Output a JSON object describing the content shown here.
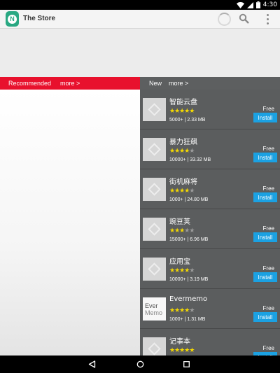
{
  "status_bar": {
    "time": "4:30",
    "icons": [
      "wifi-icon",
      "cellular-signal-icon",
      "battery-icon"
    ]
  },
  "action_bar": {
    "title": "The Store",
    "app_icon_letter": "N"
  },
  "recommended": {
    "label": "Recommended",
    "more": "more >"
  },
  "new_section": {
    "label": "New",
    "more": "more >",
    "apps": [
      {
        "name": "智能云盘",
        "rating": 5,
        "meta": "5000+ | 2.33 MB",
        "price": "Free",
        "install": "Install",
        "thumb": "placeholder"
      },
      {
        "name": "暴力狂飙",
        "rating": 4,
        "meta": "10000+ | 33.32 MB",
        "price": "Free",
        "install": "Install",
        "thumb": "placeholder"
      },
      {
        "name": "街机麻将",
        "rating": 4,
        "meta": "1000+ | 24.80 MB",
        "price": "Free",
        "install": "Install",
        "thumb": "placeholder"
      },
      {
        "name": "豌豆荚",
        "rating": 3,
        "meta": "15000+ | 6.96 MB",
        "price": "Free",
        "install": "Install",
        "thumb": "placeholder"
      },
      {
        "name": "应用宝",
        "rating": 4,
        "meta": "10000+ | 3.19 MB",
        "price": "Free",
        "install": "Install",
        "thumb": "placeholder"
      },
      {
        "name": "Evermemo",
        "rating": 4,
        "meta": "1000+ | 1.31 MB",
        "price": "Free",
        "install": "Install",
        "thumb": "evermemo",
        "thumb_text": [
          "Ever",
          "Memo"
        ]
      },
      {
        "name": "记事本",
        "rating": 5,
        "meta": "",
        "price": "Free",
        "install": "Install",
        "thumb": "placeholder"
      }
    ]
  },
  "nav_bar": {
    "buttons": [
      "back-icon",
      "home-icon",
      "recents-icon"
    ]
  },
  "colors": {
    "accent_red": "#e8112d",
    "install_blue": "#1ba1e2",
    "star_yellow": "#f4d800",
    "app_green": "#29a882"
  }
}
